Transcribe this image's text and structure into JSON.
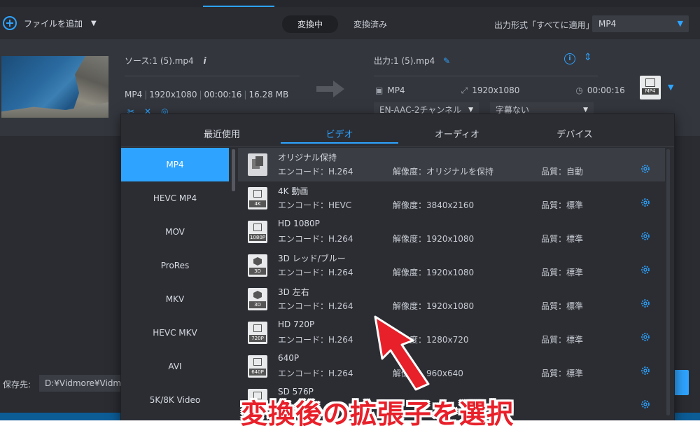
{
  "toolbar": {
    "add_file_label": "ファイルを追加",
    "tabs": [
      "変換中",
      "変換済み"
    ],
    "output_format_label": "出力形式「すべてに適用」:",
    "output_format_value": "MP4"
  },
  "file": {
    "source_name": "ソース:1 (5).mp4",
    "source_info_icon": "i",
    "source_meta": [
      "MP4",
      "1920x1080",
      "00:00:16",
      "16.28 MB"
    ],
    "output_name": "出力:1 (5).mp4",
    "output_format": "MP4",
    "output_resolution": "1920x1080",
    "output_duration": "00:00:16",
    "audio_track": "EN-AAC-2チャンネル",
    "subtitle": "字幕ない",
    "format_icon_label": "MP4"
  },
  "panel": {
    "tabs": [
      "最近使用",
      "ビデオ",
      "オーディオ",
      "デバイス"
    ],
    "active_tab": "ビデオ",
    "categories": [
      "MP4",
      "HEVC MP4",
      "MOV",
      "ProRes",
      "MKV",
      "HEVC MKV",
      "AVI",
      "5K/8K Video"
    ],
    "active_category": "MP4",
    "presets": [
      {
        "name": "オリジナル保持",
        "encode": "エンコード：H.264",
        "resolution": "解像度：オリジナルを保持",
        "quality": "品質：自動",
        "tag": ""
      },
      {
        "name": "4K 動画",
        "encode": "エンコード：HEVC",
        "resolution": "解像度：3840x2160",
        "quality": "品質：標準",
        "tag": "4K"
      },
      {
        "name": "HD 1080P",
        "encode": "エンコード：H.264",
        "resolution": "解像度：1920x1080",
        "quality": "品質：標準",
        "tag": "1080P"
      },
      {
        "name": "3D レッド/ブルー",
        "encode": "エンコード：H.264",
        "resolution": "解像度：1920x1080",
        "quality": "品質：標準",
        "tag": "3D"
      },
      {
        "name": "3D 左右",
        "encode": "エンコード：H.264",
        "resolution": "解像度：1920x1080",
        "quality": "品質：標準",
        "tag": "3D"
      },
      {
        "name": "HD 720P",
        "encode": "エンコード：H.264",
        "resolution": "解像度：1280x720",
        "quality": "品質：標準",
        "tag": "720P"
      },
      {
        "name": "640P",
        "encode": "エンコード：H.264",
        "resolution": "解像度：960x640",
        "quality": "品質：標準",
        "tag": "640P"
      },
      {
        "name": "SD 576P",
        "encode": "",
        "resolution": "",
        "quality": "",
        "tag": "576P"
      }
    ]
  },
  "bottom": {
    "save_label": "保存先:",
    "save_path": "D:¥Vidmore¥Vidmore"
  },
  "annotation": {
    "text": "変換後の拡張子を選択",
    "color": "#e8202a"
  },
  "colors": {
    "accent": "#2ea3ff",
    "background": "#2a2c32"
  }
}
